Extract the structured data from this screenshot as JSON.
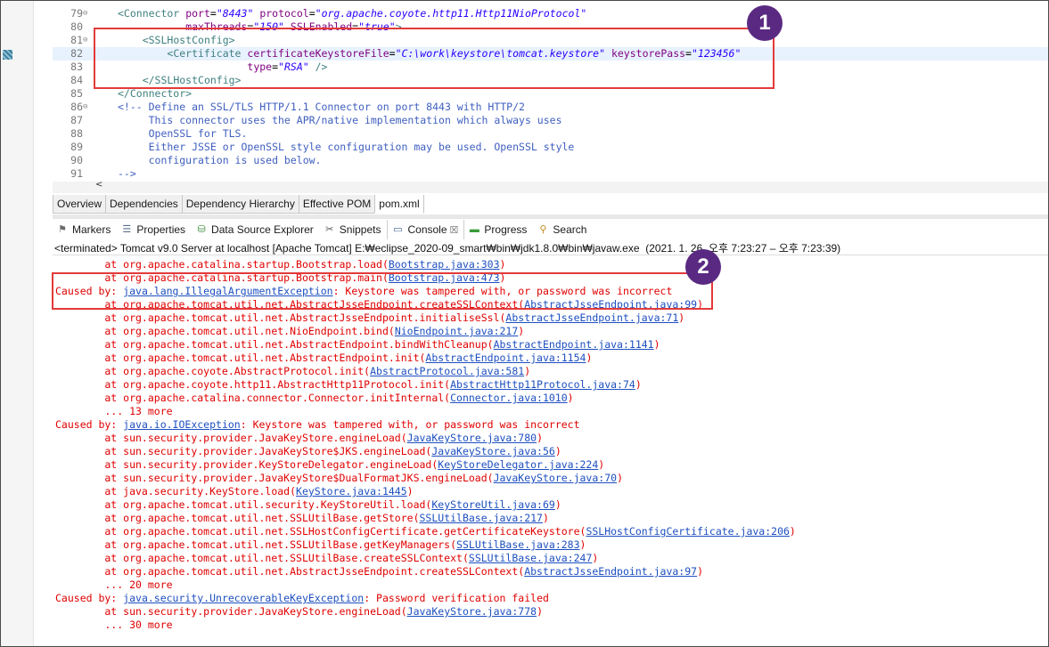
{
  "editor": {
    "lines": [
      {
        "num": "79",
        "fold": "⊖",
        "html": "<span class=\"tag\">&lt;Connector</span> <span class=\"attr\">port</span>=<span class=\"val\">\"8443\"</span> <span class=\"attr\">protocol</span>=<span class=\"val\">\"org.apache.coyote.http11.Http11NioProtocol\"</span>"
      },
      {
        "num": "80",
        "fold": "",
        "html": "           <span class=\"attr\">maxThreads</span>=<span class=\"val\">\"150\"</span> <span class=\"attr\">SSLEnabled</span>=<span class=\"val\">\"true\"</span><span class=\"tag\">&gt;</span>"
      },
      {
        "num": "81",
        "fold": "⊖",
        "html": "    <span class=\"tag\">&lt;SSLHostConfig&gt;</span>"
      },
      {
        "num": "82",
        "fold": "",
        "html": "        <span class=\"tag\">&lt;Certificate</span> <span class=\"attr\">certificateKeystoreFile</span>=<span class=\"val\">\"C:\\work\\keystore\\tomcat.keystore\"</span> <span class=\"attr\">keystorePass</span>=<span class=\"val\">\"123456\"</span>"
      },
      {
        "num": "83",
        "fold": "",
        "html": "                     <span class=\"attr\">type</span>=<span class=\"val\">\"RSA\"</span> <span class=\"tag\">/&gt;</span>"
      },
      {
        "num": "84",
        "fold": "",
        "html": "    <span class=\"tag\">&lt;/SSLHostConfig&gt;</span>"
      },
      {
        "num": "85",
        "fold": "",
        "html": "<span class=\"tag\">&lt;/Connector&gt;</span>"
      },
      {
        "num": "86",
        "fold": "⊖",
        "html": "<span class=\"cmt\">&lt;!-- Define an SSL/TLS HTTP/1.1 Connector on port 8443 with HTTP/2</span>"
      },
      {
        "num": "87",
        "fold": "",
        "html": "<span class=\"cmt\">     This connector uses the APR/native implementation which always uses</span>"
      },
      {
        "num": "88",
        "fold": "",
        "html": "<span class=\"cmt\">     OpenSSL for TLS.</span>"
      },
      {
        "num": "89",
        "fold": "",
        "html": "<span class=\"cmt\">     Either JSSE or OpenSSL style configuration may be used. OpenSSL style</span>"
      },
      {
        "num": "90",
        "fold": "",
        "html": "<span class=\"cmt\">     configuration is used below.</span>"
      },
      {
        "num": "91",
        "fold": "",
        "html": "<span class=\"cmt\">--&gt;</span>"
      }
    ],
    "scroll_left": "<"
  },
  "editor_tabs": [
    "Overview",
    "Dependencies",
    "Dependency Hierarchy",
    "Effective POM",
    "pom.xml"
  ],
  "view_tabs": [
    {
      "label": "Markers",
      "icon": "markers-icon"
    },
    {
      "label": "Properties",
      "icon": "properties-icon"
    },
    {
      "label": "Data Source Explorer",
      "icon": "data-source-icon"
    },
    {
      "label": "Snippets",
      "icon": "snippets-icon"
    },
    {
      "label": "Console",
      "icon": "console-icon",
      "close": "☒"
    },
    {
      "label": "Progress",
      "icon": "progress-icon"
    },
    {
      "label": "Search",
      "icon": "search-icon"
    }
  ],
  "terminated_line": "<terminated> Tomcat v9.0 Server at localhost [Apache Tomcat] E:₩eclipse_2020-09_smart₩bin₩jdk1.8.0₩bin₩javaw.exe  (2021. 1. 26. 오후 7:23:27 – 오후 7:23:39)",
  "console": [
    {
      "t": "        at org.apache.catalina.startup.Bootstrap.load(",
      "l": "Bootstrap.java:303",
      "e": ")"
    },
    {
      "t": "        at org.apache.catalina.startup.Bootstrap.main(",
      "l": "Bootstrap.java:473",
      "e": ")"
    },
    {
      "t": "Caused by: ",
      "l": "java.lang.IllegalArgumentException",
      "e": ": Keystore was tampered with, or password was incorrect"
    },
    {
      "t": "        at org.apache.tomcat.util.net.AbstractJsseEndpoint.createSSLContext(",
      "l": "AbstractJsseEndpoint.java:99",
      "e": ")"
    },
    {
      "t": "        at org.apache.tomcat.util.net.AbstractJsseEndpoint.initialiseSsl(",
      "l": "AbstractJsseEndpoint.java:71",
      "e": ")"
    },
    {
      "t": "        at org.apache.tomcat.util.net.NioEndpoint.bind(",
      "l": "NioEndpoint.java:217",
      "e": ")"
    },
    {
      "t": "        at org.apache.tomcat.util.net.AbstractEndpoint.bindWithCleanup(",
      "l": "AbstractEndpoint.java:1141",
      "e": ")"
    },
    {
      "t": "        at org.apache.tomcat.util.net.AbstractEndpoint.init(",
      "l": "AbstractEndpoint.java:1154",
      "e": ")"
    },
    {
      "t": "        at org.apache.coyote.AbstractProtocol.init(",
      "l": "AbstractProtocol.java:581",
      "e": ")"
    },
    {
      "t": "        at org.apache.coyote.http11.AbstractHttp11Protocol.init(",
      "l": "AbstractHttp11Protocol.java:74",
      "e": ")"
    },
    {
      "t": "        at org.apache.catalina.connector.Connector.initInternal(",
      "l": "Connector.java:1010",
      "e": ")"
    },
    {
      "t": "        ... 13 more",
      "l": "",
      "e": ""
    },
    {
      "t": "Caused by: ",
      "l": "java.io.IOException",
      "e": ": Keystore was tampered with, or password was incorrect"
    },
    {
      "t": "        at sun.security.provider.JavaKeyStore.engineLoad(",
      "l": "JavaKeyStore.java:780",
      "e": ")"
    },
    {
      "t": "        at sun.security.provider.JavaKeyStore$JKS.engineLoad(",
      "l": "JavaKeyStore.java:56",
      "e": ")"
    },
    {
      "t": "        at sun.security.provider.KeyStoreDelegator.engineLoad(",
      "l": "KeyStoreDelegator.java:224",
      "e": ")"
    },
    {
      "t": "        at sun.security.provider.JavaKeyStore$DualFormatJKS.engineLoad(",
      "l": "JavaKeyStore.java:70",
      "e": ")"
    },
    {
      "t": "        at java.security.KeyStore.load(",
      "l": "KeyStore.java:1445",
      "e": ")"
    },
    {
      "t": "        at org.apache.tomcat.util.security.KeyStoreUtil.load(",
      "l": "KeyStoreUtil.java:69",
      "e": ")"
    },
    {
      "t": "        at org.apache.tomcat.util.net.SSLUtilBase.getStore(",
      "l": "SSLUtilBase.java:217",
      "e": ")"
    },
    {
      "t": "        at org.apache.tomcat.util.net.SSLHostConfigCertificate.getCertificateKeystore(",
      "l": "SSLHostConfigCertificate.java:206",
      "e": ")"
    },
    {
      "t": "        at org.apache.tomcat.util.net.SSLUtilBase.getKeyManagers(",
      "l": "SSLUtilBase.java:283",
      "e": ")"
    },
    {
      "t": "        at org.apache.tomcat.util.net.SSLUtilBase.createSSLContext(",
      "l": "SSLUtilBase.java:247",
      "e": ")"
    },
    {
      "t": "        at org.apache.tomcat.util.net.AbstractJsseEndpoint.createSSLContext(",
      "l": "AbstractJsseEndpoint.java:97",
      "e": ")"
    },
    {
      "t": "        ... 20 more",
      "l": "",
      "e": ""
    },
    {
      "t": "Caused by: ",
      "l": "java.security.UnrecoverableKeyException",
      "e": ": Password verification failed"
    },
    {
      "t": "        at sun.security.provider.JavaKeyStore.engineLoad(",
      "l": "JavaKeyStore.java:778",
      "e": ")"
    },
    {
      "t": "        ... 30 more",
      "l": "",
      "e": ""
    }
  ],
  "annotations": {
    "badge1": "1",
    "badge2": "2"
  },
  "colors": {
    "annotation_box": "#e33a3a",
    "badge": "#5a2a82",
    "error_text": "#e00000",
    "link": "#1d4fbf"
  }
}
